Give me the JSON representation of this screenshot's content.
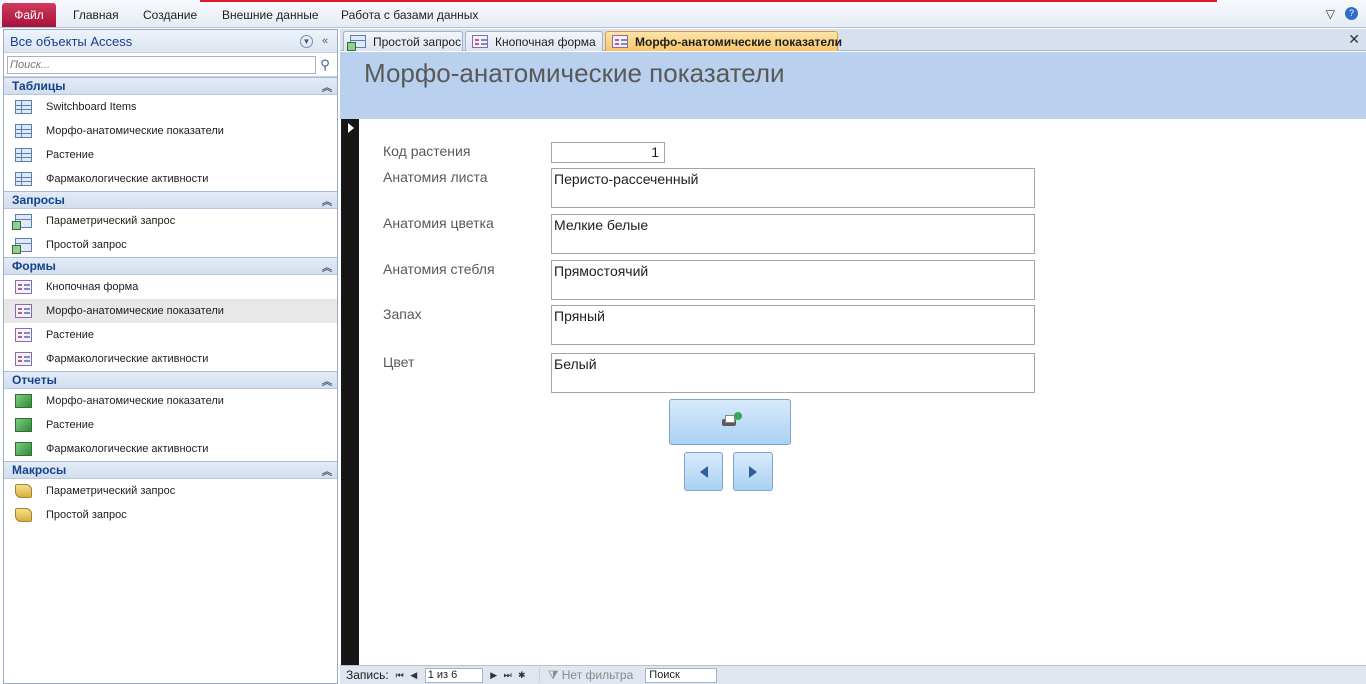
{
  "ribbon": {
    "file_tab": "Файл",
    "tabs": [
      "Главная",
      "Создание",
      "Внешние данные",
      "Работа с базами данных"
    ]
  },
  "nav_pane": {
    "title": "Все объекты Access",
    "search_placeholder": "Поиск...",
    "groups": [
      {
        "title": "Таблицы",
        "items": [
          "Switchboard Items",
          "Морфо-анатомические показатели",
          "Растение",
          "Фармакологические активности"
        ]
      },
      {
        "title": "Запросы",
        "items": [
          "Параметрический запрос",
          "Простой запрос"
        ]
      },
      {
        "title": "Формы",
        "items": [
          "Кнопочная форма",
          "Морфо-анатомические показатели",
          "Растение",
          "Фармакологические активности"
        ]
      },
      {
        "title": "Отчеты",
        "items": [
          "Морфо-анатомические показатели",
          "Растение",
          "Фармакологические активности"
        ]
      },
      {
        "title": "Макросы",
        "items": [
          "Параметрический запрос",
          "Простой запрос"
        ]
      }
    ]
  },
  "doc_tabs": [
    "Простой запрос",
    "Кнопочная форма",
    "Морфо-анатомические показатели"
  ],
  "form": {
    "title": "Морфо-анатомические показатели",
    "fields": [
      {
        "label": "Код растения",
        "value": "1"
      },
      {
        "label": "Анатомия листа",
        "value": "Перисто-рассеченный"
      },
      {
        "label": "Анатомия цветка",
        "value": "Мелкие белые"
      },
      {
        "label": "Анатомия стебля",
        "value": "Прямостоячий"
      },
      {
        "label": "Запах",
        "value": "Пряный"
      },
      {
        "label": "Цвет",
        "value": "Белый"
      }
    ]
  },
  "status_bar": {
    "record_label": "Запись:",
    "record_position": "1 из 6",
    "filter_status": "Нет фильтра",
    "search_label": "Поиск"
  },
  "colors": {
    "file_tab": "#b81a44",
    "form_header": "#b9d1ee",
    "active_tab": "#f7c56a"
  }
}
